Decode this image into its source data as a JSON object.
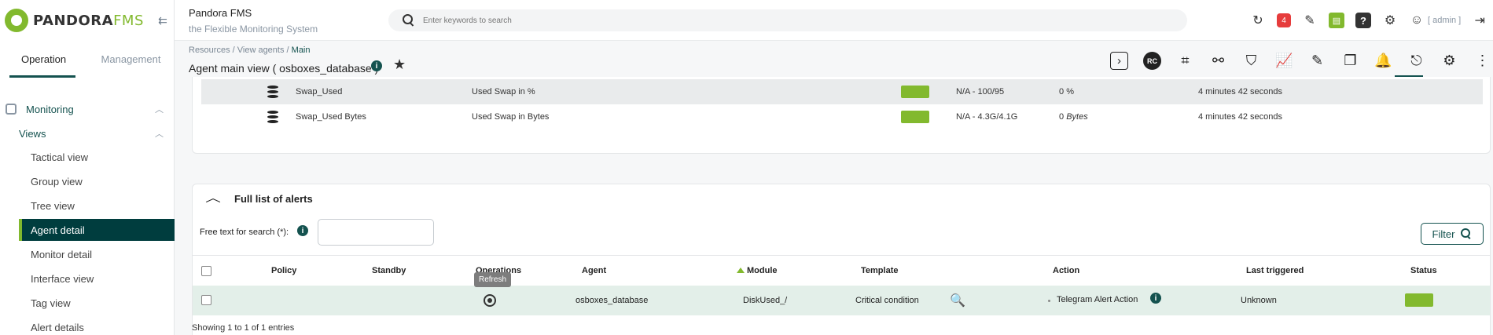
{
  "app": {
    "title": "Pandora FMS",
    "subtitle": "the Flexible Monitoring System",
    "logo_main": "PANDORA",
    "logo_accent": "FMS"
  },
  "search": {
    "placeholder": "Enter keywords to search"
  },
  "header": {
    "notification_count": "4",
    "user_label": "[ admin ]"
  },
  "sidebar": {
    "tabs": [
      "Operation",
      "Management"
    ],
    "group": "Monitoring",
    "subgroup": "Views",
    "items": [
      "Tactical view",
      "Group view",
      "Tree view",
      "Agent detail",
      "Monitor detail",
      "Interface view",
      "Tag view",
      "Alert details"
    ],
    "active_item": "Agent detail"
  },
  "breadcrumb": {
    "parts": [
      "Resources",
      "View agents"
    ],
    "current": "Main"
  },
  "page": {
    "title": "Agent main view ( osboxes_database )"
  },
  "modules": [
    {
      "name": "Swap_Used",
      "description": "Used Swap in %",
      "thresholds": "N/A - 100/95",
      "value": "0",
      "unit": "%",
      "last_contact": "4 minutes 42 seconds",
      "status_color": "#82b92e"
    },
    {
      "name": "Swap_Used Bytes",
      "description": "Used Swap in Bytes",
      "thresholds": "N/A - 4.3G/4.1G",
      "value": "0",
      "unit": "Bytes",
      "last_contact": "4 minutes 42 seconds",
      "status_color": "#82b92e"
    }
  ],
  "alerts": {
    "title": "Full list of alerts",
    "search_label": "Free text for search (*):",
    "search_value": "",
    "filter_label": "Filter",
    "columns": [
      "Policy",
      "Standby",
      "Operations",
      "Agent",
      "Module",
      "Template",
      "Action",
      "Last triggered",
      "Status"
    ],
    "sort_column": "Module",
    "rows": [
      {
        "agent": "osboxes_database",
        "module": "DiskUsed_/",
        "template": "Critical condition",
        "action": "Telegram Alert Action",
        "last_triggered": "Unknown",
        "status_color": "#82b92e"
      }
    ],
    "tooltip": "Refresh",
    "footer": "Showing 1 to 1 of 1 entries"
  },
  "colors": {
    "accent": "#82b92e",
    "primary": "#14524f",
    "sidebar_active": "#003d3e",
    "badge": "#e63c3c"
  }
}
